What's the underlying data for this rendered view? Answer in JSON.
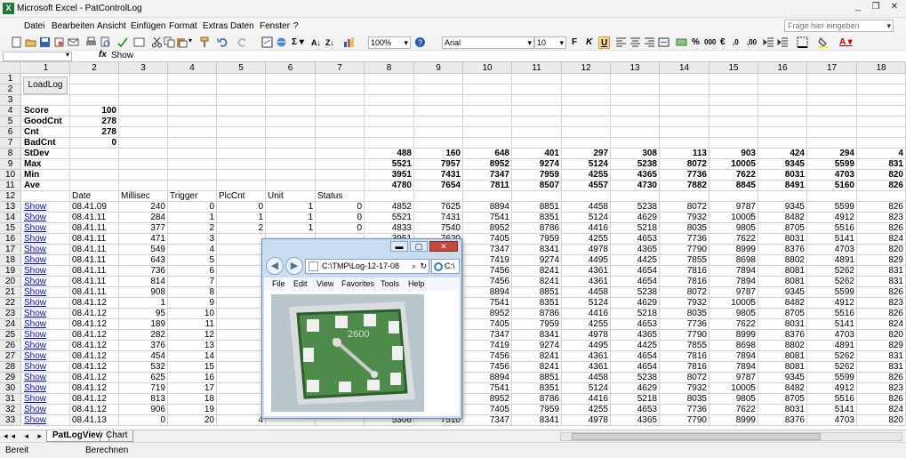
{
  "window": {
    "title": "Microsoft Excel - PatControlLog",
    "minimize": "_",
    "restore": "❐",
    "close": "✕"
  },
  "menu": {
    "items": [
      "Datei",
      "Bearbeiten",
      "Ansicht",
      "Einfügen",
      "Format",
      "Extras",
      "Daten",
      "Fenster",
      "?"
    ],
    "help_placeholder": "Frage hier eingeben"
  },
  "toolbar": {
    "zoom": "100%",
    "font": "Arial",
    "font_size": "10",
    "bold": "F",
    "italic": "K",
    "underline": "U",
    "percent": "%",
    "thousands": "000",
    "euro": "€"
  },
  "formula_bar": {
    "name_box": "",
    "fx": "fx",
    "content": "Show"
  },
  "columns": [
    "1",
    "2",
    "3",
    "4",
    "5",
    "6",
    "7",
    "8",
    "9",
    "10",
    "11",
    "12",
    "13",
    "14",
    "15",
    "16",
    "17",
    "18"
  ],
  "load_button": "LoadLog",
  "rows": [
    {
      "n": "1",
      "c": [
        "",
        "",
        "",
        "",
        "",
        "",
        "",
        "",
        "",
        "",
        "",
        "",
        "",
        "",
        "",
        "",
        "",
        ""
      ]
    },
    {
      "n": "2",
      "c": [
        "",
        "",
        "",
        "",
        "",
        "",
        "",
        "",
        "",
        "",
        "",
        "",
        "",
        "",
        "",
        "",
        "",
        ""
      ]
    },
    {
      "n": "3",
      "c": [
        "",
        "",
        "",
        "",
        "",
        "",
        "",
        "",
        "",
        "",
        "",
        "",
        "",
        "",
        "",
        "",
        "",
        ""
      ]
    },
    {
      "n": "4",
      "c": [
        "Score",
        "100",
        "",
        "",
        "",
        "",
        "",
        "",
        "",
        "",
        "",
        "",
        "",
        "",
        "",
        "",
        "",
        ""
      ]
    },
    {
      "n": "5",
      "c": [
        "GoodCnt",
        "278",
        "",
        "",
        "",
        "",
        "",
        "",
        "",
        "",
        "",
        "",
        "",
        "",
        "",
        "",
        "",
        ""
      ]
    },
    {
      "n": "6",
      "c": [
        "Cnt",
        "278",
        "",
        "",
        "",
        "",
        "",
        "",
        "",
        "",
        "",
        "",
        "",
        "",
        "",
        "",
        "",
        ""
      ]
    },
    {
      "n": "7",
      "c": [
        "BadCnt",
        "0",
        "",
        "",
        "",
        "",
        "",
        "",
        "",
        "",
        "",
        "",
        "",
        "",
        "",
        "",
        "",
        ""
      ]
    },
    {
      "n": "8",
      "c": [
        "StDev",
        "",
        "",
        "",
        "",
        "",
        "",
        "488",
        "160",
        "648",
        "401",
        "297",
        "308",
        "113",
        "903",
        "424",
        "294",
        "4"
      ]
    },
    {
      "n": "9",
      "c": [
        "Max",
        "",
        "",
        "",
        "",
        "",
        "",
        "5521",
        "7957",
        "8952",
        "9274",
        "5124",
        "5238",
        "8072",
        "10005",
        "9345",
        "5599",
        "831"
      ]
    },
    {
      "n": "10",
      "c": [
        "Min",
        "",
        "",
        "",
        "",
        "",
        "",
        "3951",
        "7431",
        "7347",
        "7959",
        "4255",
        "4365",
        "7736",
        "7622",
        "8031",
        "4703",
        "820"
      ]
    },
    {
      "n": "11",
      "c": [
        "Ave",
        "",
        "",
        "",
        "",
        "",
        "",
        "4780",
        "7654",
        "7811",
        "8507",
        "4557",
        "4730",
        "7882",
        "8845",
        "8491",
        "5160",
        "826"
      ]
    },
    {
      "n": "12",
      "c": [
        "",
        "Date",
        "Millisec",
        "Trigger",
        "PlcCnt",
        "Unit",
        "Status",
        "",
        "",
        "",
        "",
        "",
        "",
        "",
        "",
        "",
        "",
        ""
      ]
    },
    {
      "n": "13",
      "c": [
        "Show",
        "08.41.09",
        "240",
        "0",
        "0",
        "1",
        "0",
        "4852",
        "7625",
        "8894",
        "8851",
        "4458",
        "5238",
        "8072",
        "9787",
        "9345",
        "5599",
        "826"
      ]
    },
    {
      "n": "14",
      "c": [
        "Show",
        "08.41.11",
        "284",
        "1",
        "1",
        "1",
        "0",
        "5521",
        "7431",
        "7541",
        "8351",
        "5124",
        "4629",
        "7932",
        "10005",
        "8482",
        "4912",
        "823"
      ]
    },
    {
      "n": "15",
      "c": [
        "Show",
        "08.41.11",
        "377",
        "2",
        "2",
        "1",
        "0",
        "4833",
        "7540",
        "8952",
        "8786",
        "4416",
        "5218",
        "8035",
        "9805",
        "8705",
        "5516",
        "826"
      ]
    },
    {
      "n": "16",
      "c": [
        "Show",
        "08.41.11",
        "471",
        "3",
        "",
        "",
        "",
        "3951",
        "7620",
        "7405",
        "7959",
        "4255",
        "4653",
        "7736",
        "7622",
        "8031",
        "5141",
        "824"
      ]
    },
    {
      "n": "17",
      "c": [
        "Show",
        "08.41.11",
        "549",
        "4",
        "",
        "",
        "",
        "",
        "",
        "7347",
        "8341",
        "4978",
        "4365",
        "7790",
        "8999",
        "8376",
        "4703",
        "820"
      ]
    },
    {
      "n": "18",
      "c": [
        "Show",
        "08.41.11",
        "643",
        "5",
        "",
        "",
        "",
        "",
        "",
        "7419",
        "9274",
        "4495",
        "4425",
        "7855",
        "8698",
        "8802",
        "4891",
        "829"
      ]
    },
    {
      "n": "19",
      "c": [
        "Show",
        "08.41.11",
        "736",
        "6",
        "",
        "",
        "",
        "",
        "",
        "7456",
        "8241",
        "4361",
        "4654",
        "7816",
        "7894",
        "8081",
        "5262",
        "831"
      ]
    },
    {
      "n": "20",
      "c": [
        "Show",
        "08.41.11",
        "814",
        "7",
        "",
        "",
        "",
        "",
        "",
        "7456",
        "8241",
        "4361",
        "4654",
        "7816",
        "7894",
        "8081",
        "5262",
        "831"
      ]
    },
    {
      "n": "21",
      "c": [
        "Show",
        "08.41.11",
        "908",
        "8",
        "",
        "",
        "",
        "",
        "",
        "8894",
        "8851",
        "4458",
        "5238",
        "8072",
        "9787",
        "9345",
        "5599",
        "826"
      ]
    },
    {
      "n": "22",
      "c": [
        "Show",
        "08.41.12",
        "1",
        "9",
        "",
        "",
        "",
        "",
        "",
        "7541",
        "8351",
        "5124",
        "4629",
        "7932",
        "10005",
        "8482",
        "4912",
        "823"
      ]
    },
    {
      "n": "23",
      "c": [
        "Show",
        "08.41.12",
        "95",
        "10",
        "",
        "",
        "",
        "",
        "",
        "8952",
        "8786",
        "4416",
        "5218",
        "8035",
        "9805",
        "8705",
        "5516",
        "826"
      ]
    },
    {
      "n": "24",
      "c": [
        "Show",
        "08.41.12",
        "189",
        "11",
        "",
        "",
        "",
        "",
        "",
        "7405",
        "7959",
        "4255",
        "4653",
        "7736",
        "7622",
        "8031",
        "5141",
        "824"
      ]
    },
    {
      "n": "25",
      "c": [
        "Show",
        "08.41.12",
        "282",
        "12",
        "",
        "",
        "",
        "",
        "",
        "7347",
        "8341",
        "4978",
        "4365",
        "7790",
        "8999",
        "8376",
        "4703",
        "820"
      ]
    },
    {
      "n": "26",
      "c": [
        "Show",
        "08.41.12",
        "376",
        "13",
        "",
        "",
        "",
        "",
        "",
        "7419",
        "9274",
        "4495",
        "4425",
        "7855",
        "8698",
        "8802",
        "4891",
        "829"
      ]
    },
    {
      "n": "27",
      "c": [
        "Show",
        "08.41.12",
        "454",
        "14",
        "",
        "",
        "",
        "",
        "",
        "7456",
        "8241",
        "4361",
        "4654",
        "7816",
        "7894",
        "8081",
        "5262",
        "831"
      ]
    },
    {
      "n": "28",
      "c": [
        "Show",
        "08.41.12",
        "532",
        "15",
        "",
        "",
        "",
        "",
        "",
        "7456",
        "8241",
        "4361",
        "4654",
        "7816",
        "7894",
        "8081",
        "5262",
        "831"
      ]
    },
    {
      "n": "29",
      "c": [
        "Show",
        "08.41.12",
        "625",
        "16",
        "",
        "",
        "",
        "",
        "",
        "8894",
        "8851",
        "4458",
        "5238",
        "8072",
        "9787",
        "9345",
        "5599",
        "826"
      ]
    },
    {
      "n": "30",
      "c": [
        "Show",
        "08.41.12",
        "719",
        "17",
        "",
        "",
        "",
        "",
        "",
        "7541",
        "8351",
        "5124",
        "4629",
        "7932",
        "10005",
        "8482",
        "4912",
        "823"
      ]
    },
    {
      "n": "31",
      "c": [
        "Show",
        "08.41.12",
        "813",
        "18",
        "",
        "",
        "",
        "",
        "",
        "8952",
        "8786",
        "4416",
        "5218",
        "8035",
        "9805",
        "8705",
        "5516",
        "826"
      ]
    },
    {
      "n": "32",
      "c": [
        "Show",
        "08.41.12",
        "906",
        "19",
        "",
        "",
        "",
        "",
        "",
        "7405",
        "7959",
        "4255",
        "4653",
        "7736",
        "7622",
        "8031",
        "5141",
        "824"
      ]
    },
    {
      "n": "33",
      "c": [
        "Show",
        "08.41.13",
        "0",
        "20",
        "4",
        "",
        "",
        "5306",
        "7510",
        "7347",
        "8341",
        "4978",
        "4365",
        "7790",
        "8999",
        "8376",
        "4703",
        "820"
      ]
    }
  ],
  "sheets": {
    "nav": "◂◂ ◂ ▸ ▸▸",
    "tabs": [
      "PatLogView",
      "Chart"
    ]
  },
  "status": {
    "left": "Bereit",
    "mode": "Berechnen"
  },
  "browser": {
    "address": "C:\\TMP\\Log-12-17-08",
    "search_icon": "⌕",
    "refresh_icon": "↻",
    "tab_title": "C:\\",
    "back": "◀",
    "forward": "▶",
    "menu": [
      "File",
      "Edit",
      "View",
      "Favorites",
      "Tools",
      "Help"
    ],
    "controls": {
      "minimize": "▬",
      "maximize": "▢",
      "close": "✕"
    },
    "chip_text": "2600"
  },
  "colors": {
    "link": "#0000ee",
    "header_bg": "#ebebeb",
    "board_green": "#4e8b4a",
    "ie_frame": "#c9ddf2"
  }
}
